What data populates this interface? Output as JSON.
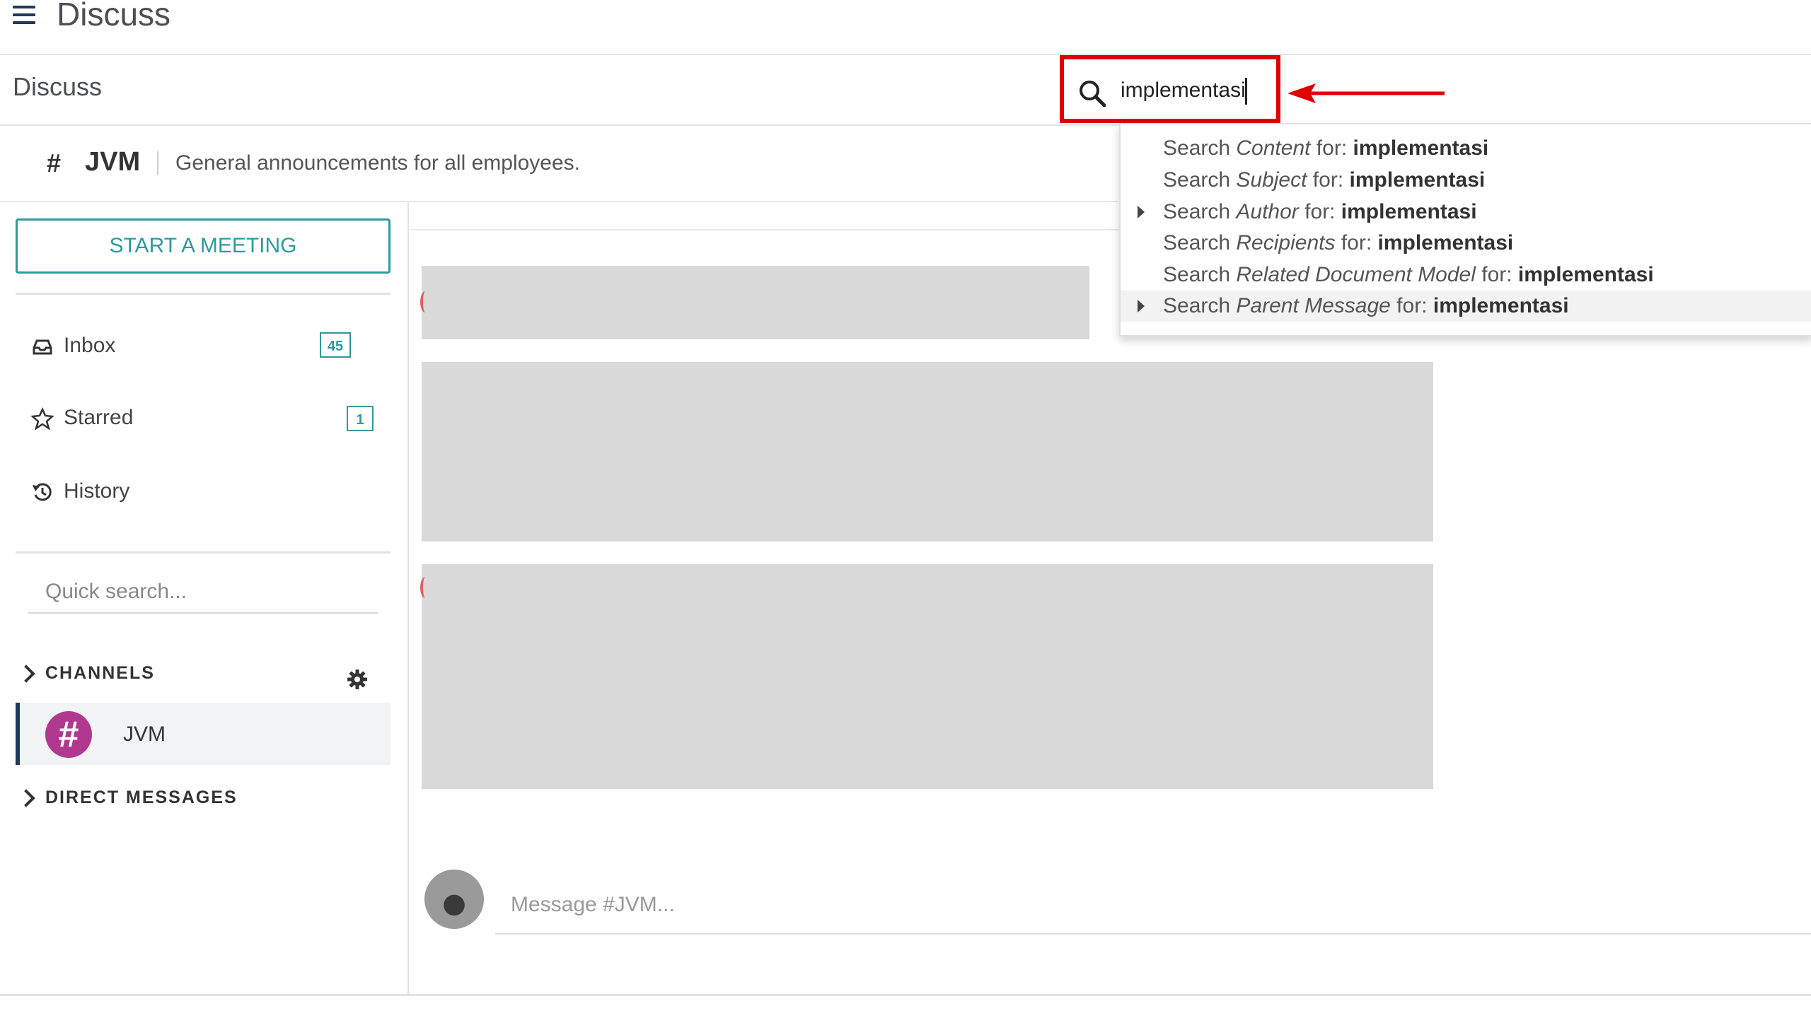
{
  "app": {
    "title": "Discuss"
  },
  "control_panel": {
    "breadcrumb": "Discuss",
    "search": {
      "value": "implementasi"
    }
  },
  "search_dropdown": {
    "items": [
      {
        "prefix": "Search ",
        "field": "Content",
        "mid": " for: ",
        "term": "implementasi",
        "expandable": false
      },
      {
        "prefix": "Search ",
        "field": "Subject",
        "mid": " for: ",
        "term": "implementasi",
        "expandable": false
      },
      {
        "prefix": "Search ",
        "field": "Author",
        "mid": " for: ",
        "term": "implementasi",
        "expandable": true
      },
      {
        "prefix": "Search ",
        "field": "Recipients",
        "mid": " for: ",
        "term": "implementasi",
        "expandable": false
      },
      {
        "prefix": "Search ",
        "field": "Related Document Model",
        "mid": " for: ",
        "term": "implementasi",
        "expandable": false
      },
      {
        "prefix": "Search ",
        "field": "Parent Message",
        "mid": " for: ",
        "term": "implementasi",
        "expandable": true
      }
    ]
  },
  "channel_header": {
    "hash": "#",
    "name": "JVM",
    "description": "General announcements for all employees."
  },
  "sidebar": {
    "meeting_button": "START A MEETING",
    "mailboxes": [
      {
        "label": "Inbox",
        "counter": "45",
        "icon": "inbox-icon"
      },
      {
        "label": "Starred",
        "counter": "1",
        "icon": "star-icon"
      },
      {
        "label": "History",
        "counter": "",
        "icon": "history-icon"
      }
    ],
    "quick_search_placeholder": "Quick search...",
    "channels_label": "CHANNELS",
    "direct_messages_label": "DIRECT MESSAGES",
    "channels": [
      {
        "name": "JVM",
        "avatar_glyph": "#"
      }
    ]
  },
  "composer": {
    "placeholder": "Message #JVM..."
  },
  "colors": {
    "accent": "#2e9a9a",
    "highlight_border": "#e00000",
    "channel_avatar": "#b0398f",
    "nav_dark": "#1f3a5c"
  }
}
